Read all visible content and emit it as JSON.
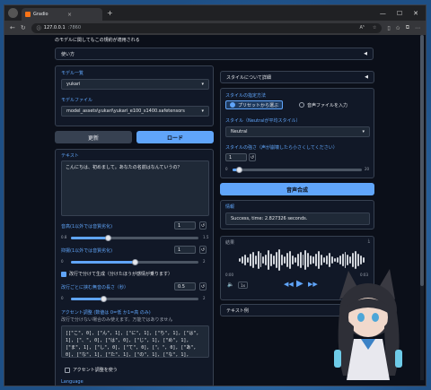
{
  "browser": {
    "tab_title": "Gradio",
    "url": "127.0.0.1",
    "url_port": ":7860",
    "zoom_badge": "A⁵"
  },
  "page": {
    "top_note": "のモデルに関してもこの規約が適用される",
    "usage_accordion": "使い方",
    "model_list_label": "モデル一覧",
    "model_list_value": "yukari",
    "model_file_label": "モデルファイル",
    "model_file_value": "model_assets\\yukari\\yukari_e100_s1400.safetensors",
    "refresh_button": "更新",
    "load_button": "ロード",
    "text_label": "テキスト",
    "text_value": "こんにちは、初めまして。あなたの名前はなんていうの？",
    "volume_label": "音高(1以外では音質劣化)",
    "volume_value": "1",
    "volume_min": "0.8",
    "volume_max": "1.5",
    "volume_level": 0.29,
    "intonation_label": "抑揚(1以外では音質劣化)",
    "intonation_value": "1",
    "intonation_min": "0",
    "intonation_max": "2",
    "intonation_level": 0.5,
    "split_checkbox": "改行で分けて生成（分けたほうが感情が乗ります）",
    "silence_label": "改行ごとに挟む無音の長さ（秒）",
    "silence_value": "0.5",
    "silence_min": "0",
    "silence_max": "2",
    "silence_level": 0.25,
    "accent_label": "アクセント調整 (数値は 0=低 か1=高 のみ)",
    "accent_note": "改行で分けない場合のみ使えます。万能ではありません",
    "accent_code": "[[\"こ\", 0], [\"ん\", 1], [\"に\", 1], [\"ち\", 1], [\"は\", 1], [\"、\", 0], [\"は\", 0], [\"じ\", 1], [\"め\", 1], [\"ま\", 1], [\"し\", 0], [\"て\", 0], [\"。\", 0], [\"あ\", 0], [\"な\", 1], [\"た\", 1], [\"の\", 1], [\"な\", 1], [\"ま\", 0], [\"え\", 0], [\"は\", 0], [\"な\", 0], [\"ん\", 1], [\"て\", 1], [\"い\", 1], [\"う\", 0], [\"の\", 1], [\"？\", 0]]",
    "accent_checkbox": "アクセント調整を使う",
    "language_label": "Language",
    "style_details": "スタイルについて詳細",
    "style_method_label": "スタイルの指定方法",
    "style_method_preset": "プリセットから選ぶ",
    "style_method_audio": "音声ファイルを入力",
    "style_label": "スタイル（Neutralが平均スタイル）",
    "style_value": "Neutral",
    "style_strength_label": "スタイルの強さ（声が崩壊したら小さくしてください）",
    "style_strength_value": "1",
    "style_strength_min": "0",
    "style_strength_max": "20",
    "style_strength_level": 0.05,
    "synthesize_button": "音声合成",
    "info_label": "情報",
    "info_value": "Success, time: 2.827326 seconds.",
    "audio_label": "結果",
    "audio_time_start": "0:00",
    "audio_time_end": "0:03",
    "audio_speed": "1x",
    "examples_accordion": "テキスト例"
  }
}
